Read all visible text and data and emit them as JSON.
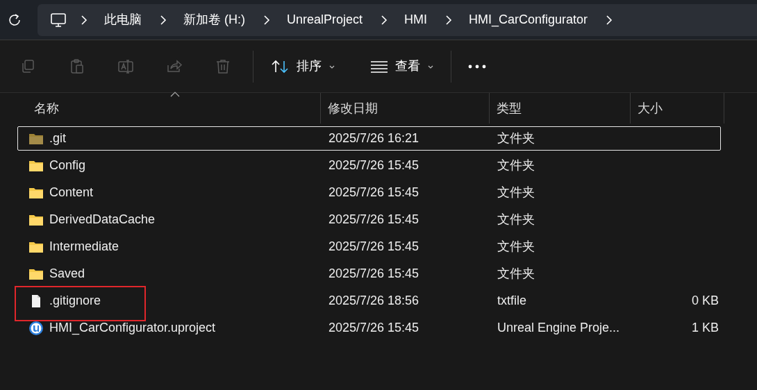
{
  "breadcrumb": [
    "此电脑",
    "新加卷 (H:)",
    "UnrealProject",
    "HMI",
    "HMI_CarConfigurator"
  ],
  "toolbar": {
    "icon_buttons": [
      {
        "kind": "copy",
        "disabled": true
      },
      {
        "kind": "paste",
        "disabled": true
      },
      {
        "kind": "rename",
        "disabled": true
      },
      {
        "kind": "share",
        "disabled": true
      },
      {
        "kind": "delete",
        "disabled": true
      }
    ],
    "sort": "排序",
    "view": "查看"
  },
  "table": {
    "columns": [
      {
        "label": "名称",
        "sorted": true
      },
      {
        "label": "修改日期",
        "sorted": false
      },
      {
        "label": "类型",
        "sorted": false
      },
      {
        "label": "大小",
        "sorted": false
      }
    ],
    "rows": [
      {
        "kind": "folder",
        "hidden": true,
        "focused": true,
        "highlighted": false,
        "name": ".git",
        "date": "2025/7/26 16:21",
        "type": "文件夹"
      },
      {
        "kind": "folder",
        "hidden": false,
        "focused": false,
        "highlighted": false,
        "name": "Config",
        "date": "2025/7/26 15:45",
        "type": "文件夹"
      },
      {
        "kind": "folder",
        "hidden": false,
        "focused": false,
        "highlighted": false,
        "name": "Content",
        "date": "2025/7/26 15:45",
        "type": "文件夹"
      },
      {
        "kind": "folder",
        "hidden": false,
        "focused": false,
        "highlighted": false,
        "name": "DerivedDataCache",
        "date": "2025/7/26 15:45",
        "type": "文件夹"
      },
      {
        "kind": "folder",
        "hidden": false,
        "focused": false,
        "highlighted": false,
        "name": "Intermediate",
        "date": "2025/7/26 15:45",
        "type": "文件夹"
      },
      {
        "kind": "folder",
        "hidden": false,
        "focused": false,
        "highlighted": false,
        "name": "Saved",
        "date": "2025/7/26 15:45",
        "type": "文件夹"
      },
      {
        "kind": "file",
        "hidden": false,
        "focused": false,
        "highlighted": true,
        "name": ".gitignore",
        "date": "2025/7/26 18:56",
        "type": "txtfile",
        "size": "0 KB"
      },
      {
        "kind": "uproject",
        "hidden": false,
        "focused": false,
        "highlighted": false,
        "name": "HMI_CarConfigurator.uproject",
        "date": "2025/7/26 15:45",
        "type": "Unreal Engine Proje...",
        "size": "1 KB"
      }
    ]
  }
}
